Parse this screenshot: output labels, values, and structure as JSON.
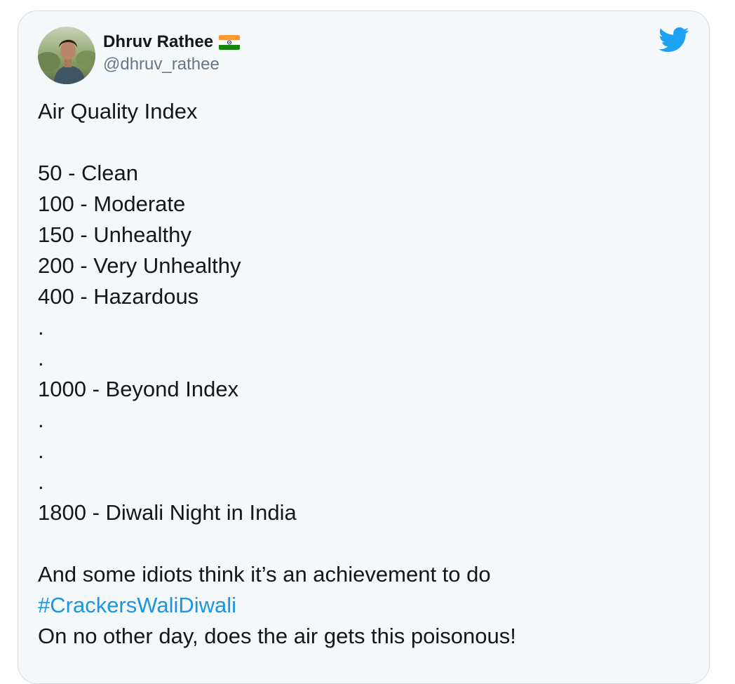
{
  "author": {
    "display_name": "Dhruv Rathee",
    "handle": "@dhruv_rathee",
    "badge": "india-flag-emoji"
  },
  "brand": {
    "icon": "twitter-bird-icon",
    "color": "#1da1f2"
  },
  "tweet": {
    "heading": "Air Quality Index",
    "scale": [
      "50 - Clean",
      "100 - Moderate",
      "150 - Unhealthy",
      "200 - Very Unhealthy",
      "400 - Hazardous",
      ".",
      ".",
      "1000 - Beyond Index",
      ".",
      ".",
      ".",
      "1800 - Diwali Night in India"
    ],
    "closing_line": "And some idiots think it’s an achievement to do",
    "hashtag": "#CrackersWaliDiwali",
    "final_line": "On no other day, does the air gets this poisonous!"
  },
  "colors": {
    "card_background": "#f5f8fa",
    "text": "#14171a",
    "secondary_text": "#657786",
    "link": "#1b95e0"
  }
}
